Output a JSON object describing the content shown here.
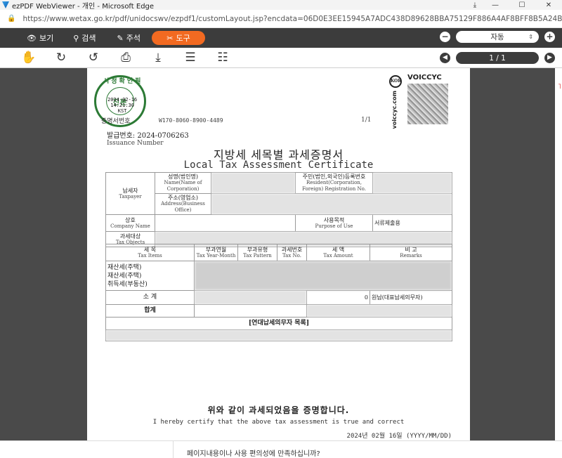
{
  "window": {
    "title": "ezPDF WebViewer - 개인 - Microsoft Edge",
    "controls": [
      "—",
      "☐",
      "✕"
    ]
  },
  "browser": {
    "url": "https://www.wetax.go.kr/pdf/unidocswv/ezpdf1/customLayout.jsp?encdata=06D0E3EE15945A7ADC438D89628BBA75129F886A4AF8BFF8B5A24B11629460D10F4..."
  },
  "toolbar": {
    "view_label": "보기",
    "search_label": "검색",
    "annotate_label": "주석",
    "tools_label": "도구",
    "zoom_value": "자동"
  },
  "paging": {
    "page_indicator": "1 / 1"
  },
  "document": {
    "stamp": {
      "top_text": "시청확인필",
      "center_word": "진본",
      "date": "2024-02-16",
      "time": "14:21:30",
      "tz": "KST",
      "bottom_text": "행정정보공동이용센터"
    },
    "stamp_label": "증명서번호",
    "cert_code": "W170-8060-8900-4489",
    "page_no": "1/1",
    "qr_brand": "VOICCYC",
    "qr_seal": "KOR",
    "qr_vertical": "voiccyc.com",
    "issuance_label_ko": "발급번호:",
    "issuance_value": "2024-0706263",
    "issuance_label_en": "Issuance Number",
    "title_ko": "지방세 세목별 과세증명서",
    "title_en": "Local Tax Assessment Certificate",
    "taxpayer_ko": "납세자",
    "taxpayer_en": "Taxpayer",
    "name_ko": "성명(법인명)",
    "name_en": "Name(Name of Corporation)",
    "resident_ko": "주민(법인,외국인)등록번호",
    "resident_en": "Resident(Corporation, Foreign) Registration No.",
    "address_ko": "주소(영업소)",
    "address_en": "Address(Business Office)",
    "company_ko": "상호",
    "company_en": "Company Name",
    "purpose_ko": "사용목적",
    "purpose_en": "Purpose of Use",
    "purpose_value": "서류제출용",
    "objects_ko": "과세대상",
    "objects_en": "Tax Objects",
    "col_items_ko": "세 목",
    "col_items_en": "Tax Items",
    "col_year_ko": "부과연월",
    "col_year_en": "Tax Year-Month",
    "col_pattern_ko": "부과유형",
    "col_pattern_en": "Tax Pattern",
    "col_no_ko": "과세번호",
    "col_no_en": "Tax No.",
    "col_amount_ko": "세 액",
    "col_amount_en": "Tax Amount",
    "col_remarks_ko": "비 고",
    "col_remarks_en": "Remarks",
    "tax_rows": [
      "재산세(주택)",
      "재산세(주택)",
      "취득세(부동산)"
    ],
    "subtotal_label": "소 계",
    "subtotal_value": "0",
    "subtotal_remark": "원납(대표납세의무자)",
    "total_label": "합계",
    "joint_section": "[연대납세의무자 목록]",
    "confirm_ko": "위와 같이 과세되었음을 증명합니다.",
    "confirm_en": "I hereby certify that the above tax assessment is true and correct",
    "issue_date": "2024년 02월 16일 (YYYY/MM/DD)"
  },
  "footer": {
    "survey_text": "페이지내용이나 사용 편의성에 만족하십니까?"
  }
}
